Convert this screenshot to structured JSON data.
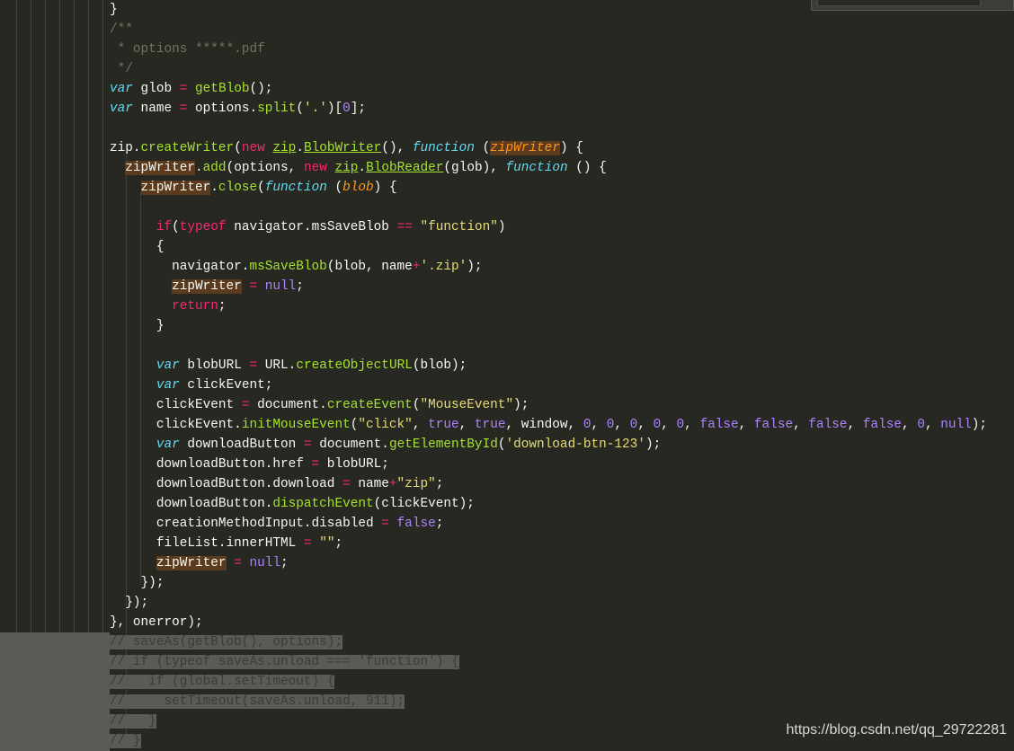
{
  "colors": {
    "background": "#272822",
    "keyword": "#f92672",
    "string": "#e6db74",
    "number": "#ae81ff",
    "function": "#a6e22e",
    "storage": "#66d9ef",
    "parameter": "#fd971f",
    "comment": "#75715e",
    "word_highlight": "#5b3a1e",
    "selection": "#595b56"
  },
  "minimap_label": "zipWriter",
  "watermark": "https://blog.csdn.net/qq_29722281",
  "code_lines": [
    [
      [
        "}",
        ""
      ]
    ],
    [
      [
        "/**",
        "c"
      ]
    ],
    [
      [
        " * options *****.pdf",
        "c"
      ]
    ],
    [
      [
        " */",
        "c"
      ]
    ],
    [
      [
        "var",
        "it"
      ],
      [
        " glob ",
        ""
      ],
      [
        "=",
        "k"
      ],
      [
        " ",
        ""
      ],
      [
        "getBlob",
        "f"
      ],
      [
        "();",
        ""
      ]
    ],
    [
      [
        "var",
        "it"
      ],
      [
        " name ",
        ""
      ],
      [
        "=",
        "k"
      ],
      [
        " options.",
        ""
      ],
      [
        "split",
        "f"
      ],
      [
        "(",
        ""
      ],
      [
        "'.'",
        "s"
      ],
      [
        ")[",
        ""
      ],
      [
        "0",
        "n"
      ],
      [
        "];",
        ""
      ]
    ],
    [],
    [
      [
        "zip.",
        ""
      ],
      [
        "createWriter",
        "f"
      ],
      [
        "(",
        ""
      ],
      [
        "new",
        "k"
      ],
      [
        " ",
        ""
      ],
      [
        "zip",
        "u"
      ],
      [
        ".",
        ""
      ],
      [
        "BlobWriter",
        "u"
      ],
      [
        "(), ",
        ""
      ],
      [
        "function",
        "it"
      ],
      [
        " (",
        ""
      ],
      [
        "zipWriter",
        "p hl"
      ],
      [
        ") {",
        ""
      ]
    ],
    [
      [
        "  ",
        ""
      ],
      [
        "zipWriter",
        "hl"
      ],
      [
        ".",
        ""
      ],
      [
        "add",
        "f"
      ],
      [
        "(options, ",
        ""
      ],
      [
        "new",
        "k"
      ],
      [
        " ",
        ""
      ],
      [
        "zip",
        "u"
      ],
      [
        ".",
        ""
      ],
      [
        "BlobReader",
        "u"
      ],
      [
        "(glob), ",
        ""
      ],
      [
        "function",
        "it"
      ],
      [
        " () {",
        ""
      ]
    ],
    [
      [
        "    ",
        ""
      ],
      [
        "zipWriter",
        "hl"
      ],
      [
        ".",
        ""
      ],
      [
        "close",
        "f"
      ],
      [
        "(",
        ""
      ],
      [
        "function",
        "it"
      ],
      [
        " (",
        ""
      ],
      [
        "blob",
        "p"
      ],
      [
        ") {",
        ""
      ]
    ],
    [],
    [
      [
        "      ",
        ""
      ],
      [
        "if",
        "k"
      ],
      [
        "(",
        ""
      ],
      [
        "typeof",
        "k"
      ],
      [
        " navigator.msSaveBlob ",
        ""
      ],
      [
        "==",
        "k"
      ],
      [
        " ",
        ""
      ],
      [
        "\"function\"",
        "s"
      ],
      [
        ")",
        ""
      ]
    ],
    [
      [
        "      {",
        ""
      ]
    ],
    [
      [
        "        navigator.",
        ""
      ],
      [
        "msSaveBlob",
        "f"
      ],
      [
        "(blob, name",
        ""
      ],
      [
        "+",
        "k"
      ],
      [
        "'.zip'",
        "s"
      ],
      [
        ");",
        ""
      ]
    ],
    [
      [
        "        ",
        ""
      ],
      [
        "zipWriter",
        "hl"
      ],
      [
        " ",
        ""
      ],
      [
        "=",
        "k"
      ],
      [
        " ",
        ""
      ],
      [
        "null",
        "n"
      ],
      [
        ";",
        ""
      ]
    ],
    [
      [
        "        ",
        ""
      ],
      [
        "return",
        "k"
      ],
      [
        ";",
        ""
      ]
    ],
    [
      [
        "      }",
        ""
      ]
    ],
    [],
    [
      [
        "      ",
        ""
      ],
      [
        "var",
        "it"
      ],
      [
        " blobURL ",
        ""
      ],
      [
        "=",
        "k"
      ],
      [
        " URL.",
        ""
      ],
      [
        "createObjectURL",
        "f"
      ],
      [
        "(blob);",
        ""
      ]
    ],
    [
      [
        "      ",
        ""
      ],
      [
        "var",
        "it"
      ],
      [
        " clickEvent;",
        ""
      ]
    ],
    [
      [
        "      clickEvent ",
        ""
      ],
      [
        "=",
        "k"
      ],
      [
        " document.",
        ""
      ],
      [
        "createEvent",
        "f"
      ],
      [
        "(",
        ""
      ],
      [
        "\"MouseEvent\"",
        "s"
      ],
      [
        ");",
        ""
      ]
    ],
    [
      [
        "      clickEvent.",
        ""
      ],
      [
        "initMouseEvent",
        "f"
      ],
      [
        "(",
        ""
      ],
      [
        "\"click\"",
        "s"
      ],
      [
        ", ",
        ""
      ],
      [
        "true",
        "n"
      ],
      [
        ", ",
        ""
      ],
      [
        "true",
        "n"
      ],
      [
        ", window, ",
        ""
      ],
      [
        "0",
        "n"
      ],
      [
        ", ",
        ""
      ],
      [
        "0",
        "n"
      ],
      [
        ", ",
        ""
      ],
      [
        "0",
        "n"
      ],
      [
        ", ",
        ""
      ],
      [
        "0",
        "n"
      ],
      [
        ", ",
        ""
      ],
      [
        "0",
        "n"
      ],
      [
        ", ",
        ""
      ],
      [
        "false",
        "n"
      ],
      [
        ", ",
        ""
      ],
      [
        "false",
        "n"
      ],
      [
        ", ",
        ""
      ],
      [
        "false",
        "n"
      ],
      [
        ", ",
        ""
      ],
      [
        "false",
        "n"
      ],
      [
        ", ",
        ""
      ],
      [
        "0",
        "n"
      ],
      [
        ", ",
        ""
      ],
      [
        "null",
        "n"
      ],
      [
        ");",
        ""
      ]
    ],
    [
      [
        "      ",
        ""
      ],
      [
        "var",
        "it"
      ],
      [
        " downloadButton ",
        ""
      ],
      [
        "=",
        "k"
      ],
      [
        " document.",
        ""
      ],
      [
        "getElementById",
        "f"
      ],
      [
        "(",
        ""
      ],
      [
        "'download-btn-123'",
        "s"
      ],
      [
        ");",
        ""
      ]
    ],
    [
      [
        "      downloadButton.href ",
        ""
      ],
      [
        "=",
        "k"
      ],
      [
        " blobURL;",
        ""
      ]
    ],
    [
      [
        "      downloadButton.download ",
        ""
      ],
      [
        "=",
        "k"
      ],
      [
        " name",
        ""
      ],
      [
        "+",
        "k"
      ],
      [
        "\"zip\"",
        "s"
      ],
      [
        ";",
        ""
      ]
    ],
    [
      [
        "      downloadButton.",
        ""
      ],
      [
        "dispatchEvent",
        "f"
      ],
      [
        "(clickEvent);",
        ""
      ]
    ],
    [
      [
        "      creationMethodInput.disabled ",
        ""
      ],
      [
        "=",
        "k"
      ],
      [
        " ",
        ""
      ],
      [
        "false",
        "n"
      ],
      [
        ";",
        ""
      ]
    ],
    [
      [
        "      fileList.innerHTML ",
        ""
      ],
      [
        "=",
        "k"
      ],
      [
        " ",
        ""
      ],
      [
        "\"\"",
        "s"
      ],
      [
        ";",
        ""
      ]
    ],
    [
      [
        "      ",
        ""
      ],
      [
        "zipWriter",
        "hl"
      ],
      [
        " ",
        ""
      ],
      [
        "=",
        "k"
      ],
      [
        " ",
        ""
      ],
      [
        "null",
        "n"
      ],
      [
        ";",
        ""
      ]
    ],
    [
      [
        "    });",
        ""
      ]
    ],
    [
      [
        "  });",
        ""
      ]
    ],
    [
      [
        "}, onerror);",
        ""
      ]
    ],
    [
      [
        "// saveAs(getBlob(), options);",
        "sel-c"
      ]
    ],
    [
      [
        "// if (typeof saveAs.unload === 'function') {",
        "sel-c"
      ]
    ],
    [
      [
        "//   if (global.setTimeout) {",
        "sel-c"
      ]
    ],
    [
      [
        "//     setTimeout(saveAs.unload, 911);",
        "sel-c"
      ]
    ],
    [
      [
        "//   }",
        "sel-c"
      ]
    ],
    [
      [
        "// }",
        "sel-c"
      ]
    ]
  ]
}
